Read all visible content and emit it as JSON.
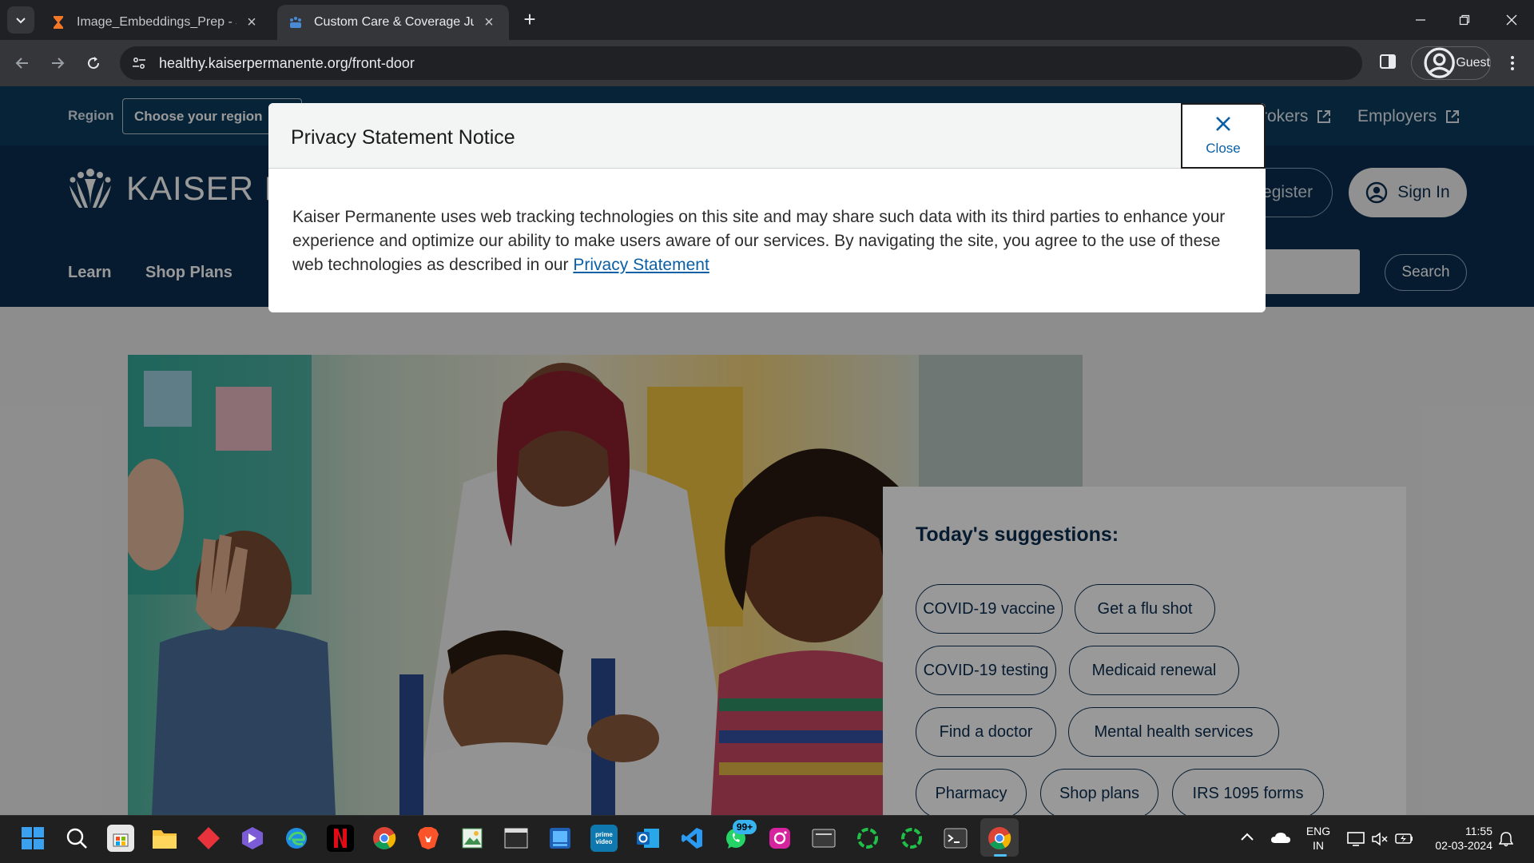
{
  "browser": {
    "tabs": [
      {
        "title": "Image_Embeddings_Prep - Jupyter",
        "active": false
      },
      {
        "title": "Custom Care & Coverage Just For You",
        "active": true
      }
    ],
    "url": "healthy.kaiserpermanente.org/front-door",
    "profile_label": "Guest"
  },
  "site": {
    "region_label": "Region",
    "region_select": "Choose your region",
    "brokers_label": "Brokers",
    "employers_label": "Employers",
    "logo_text": "KAISER PERMANENTE",
    "register_label": "Register",
    "signin_label": "Sign In",
    "nav": [
      "Learn",
      "Shop Plans"
    ],
    "search_label": "Search",
    "suggestions_title": "Today's suggestions:",
    "suggestions": [
      "COVID-19 vaccine",
      "Get a flu shot",
      "COVID-19 testing",
      "Medicaid renewal",
      "Find a doctor",
      "Mental health services",
      "Pharmacy",
      "Shop plans",
      "IRS 1095 forms"
    ]
  },
  "modal": {
    "title": "Privacy Statement Notice",
    "close_label": "Close",
    "body_text": "Kaiser Permanente uses web tracking technologies on this site and may share such data with its third parties to enhance your experience and optimize our ability to make users aware of our services. By navigating the site, you agree to the use of these web technologies as described in our ",
    "link_text": "Privacy Statement"
  },
  "taskbar": {
    "badge_count": "99+",
    "lang_line1": "ENG",
    "lang_line2": "IN",
    "time": "11:55",
    "date": "02-03-2024"
  },
  "colors": {
    "brand_navy": "#0b2d4f",
    "region_bar": "#0d3b5e",
    "link_blue": "#0b5fa5"
  }
}
